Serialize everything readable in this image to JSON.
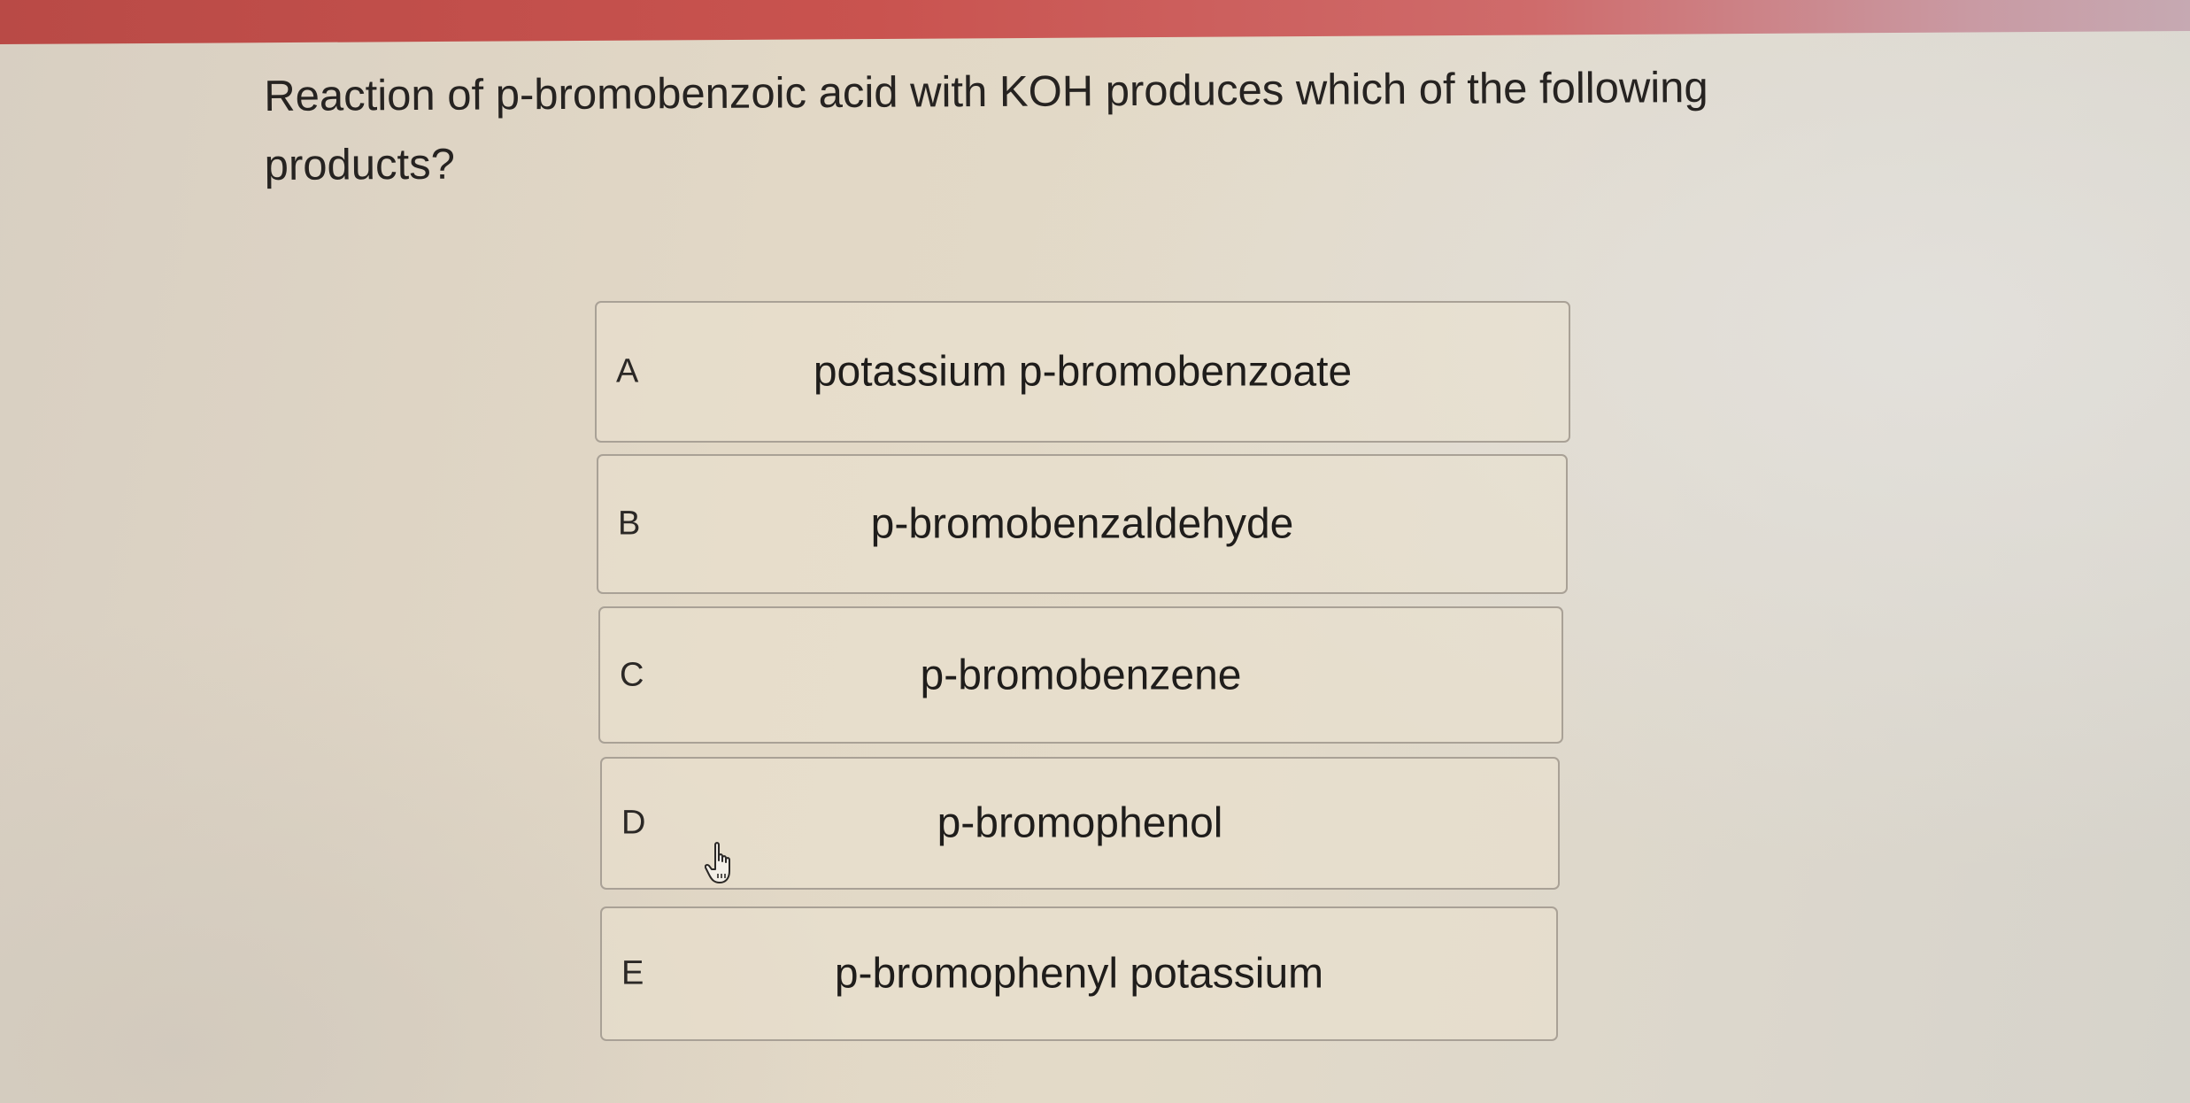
{
  "question": {
    "text": "Reaction of p-bromobenzoic acid with KOH produces which of the following products?"
  },
  "options": [
    {
      "letter": "A",
      "text": "potassium p-bromobenzoate"
    },
    {
      "letter": "B",
      "text": "p-bromobenzaldehyde"
    },
    {
      "letter": "C",
      "text": "p-bromobenzene"
    },
    {
      "letter": "D",
      "text": "p-bromophenol"
    },
    {
      "letter": "E",
      "text": "p-bromophenyl potassium"
    }
  ],
  "cursor": {
    "icon": "hand-pointer-icon"
  },
  "colors": {
    "header_bar": "#c9534f",
    "option_border": "#a9a196",
    "page_background": "#e2d8c6"
  }
}
